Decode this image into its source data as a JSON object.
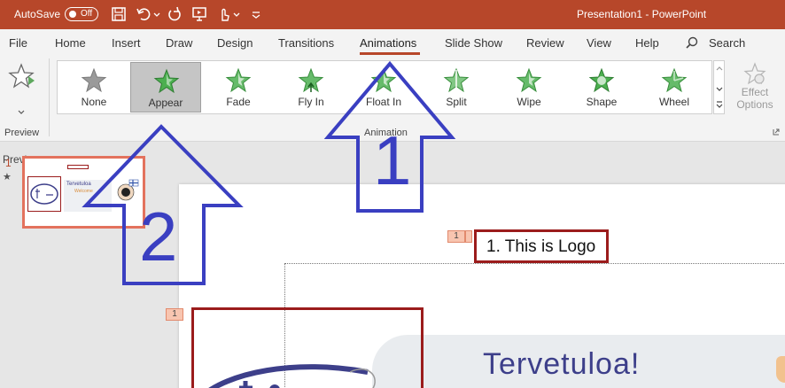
{
  "titlebar": {
    "autosave_label": "AutoSave",
    "autosave_state": "Off",
    "window_title": "Presentation1  -  PowerPoint"
  },
  "tabs": [
    {
      "label": "File"
    },
    {
      "label": "Home"
    },
    {
      "label": "Insert"
    },
    {
      "label": "Draw"
    },
    {
      "label": "Design"
    },
    {
      "label": "Transitions"
    },
    {
      "label": "Animations"
    },
    {
      "label": "Slide Show"
    },
    {
      "label": "Review"
    },
    {
      "label": "View"
    },
    {
      "label": "Help"
    }
  ],
  "search_label": "Search",
  "ribbon": {
    "preview_label": "Preview",
    "preview_group": "Preview",
    "animation_group": "Animation",
    "effects": [
      "None",
      "Appear",
      "Fade",
      "Fly In",
      "Float In",
      "Split",
      "Wipe",
      "Shape",
      "Wheel"
    ],
    "selected_effect": "Appear",
    "effect_options_line1": "Effect",
    "effect_options_line2": "Options"
  },
  "slide_pane": {
    "slide_number": "1",
    "star": "★",
    "thumb_welcome": "Tervetuloa",
    "thumb_sub": "Welcome"
  },
  "slide": {
    "tag_logo": "1",
    "tag_left": "1",
    "logo_label": "1. This is Logo",
    "welcome_text": "Tervetuloa!"
  },
  "annotations": {
    "arrow1_number": "1",
    "arrow2_number": "2"
  },
  "colors": {
    "accent": "#b7472a",
    "highlight_box": "#9b1c1c",
    "arrow": "#3a3fc1",
    "star_green": "#4caf50"
  }
}
